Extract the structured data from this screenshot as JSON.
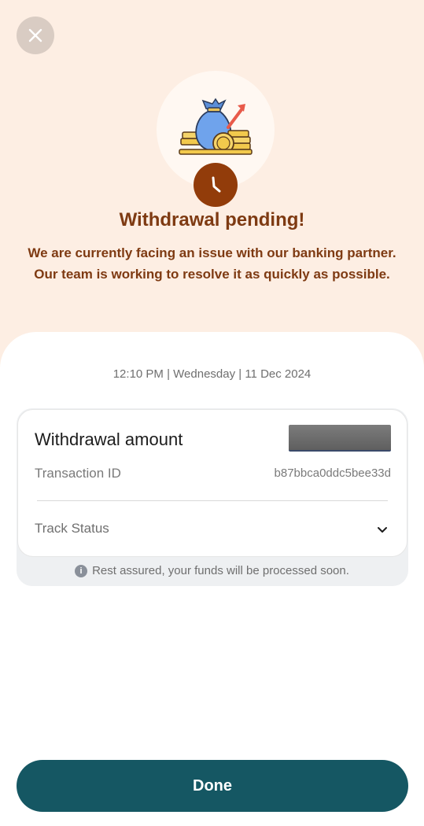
{
  "header": {
    "close_icon": "close-icon"
  },
  "hero": {
    "illustration_icon": "money-bag-with-coins-icon",
    "badge_icon": "clock-icon",
    "title": "Withdrawal pending!",
    "subtitle_line1": "We are currently facing an issue with our banking partner.",
    "subtitle_line2": "Our team is working to resolve it as quickly as possible."
  },
  "details": {
    "datetime": "12:10 PM | Wednesday | 11 Dec 2024",
    "amount_label": "Withdrawal amount",
    "amount_value": "",
    "transaction_label": "Transaction ID",
    "transaction_id": "b87bbca0ddc5bee33d",
    "track_label": "Track Status",
    "track_icon": "chevron-down-icon",
    "reassure_icon": "info-icon",
    "reassure_text": "Rest assured, your funds will be processed soon."
  },
  "footer": {
    "done_label": "Done"
  },
  "colors": {
    "top_background": "#fdeee3",
    "title_brown": "#7e3a12",
    "clock_badge": "#923c0a",
    "primary_button": "#155763"
  }
}
